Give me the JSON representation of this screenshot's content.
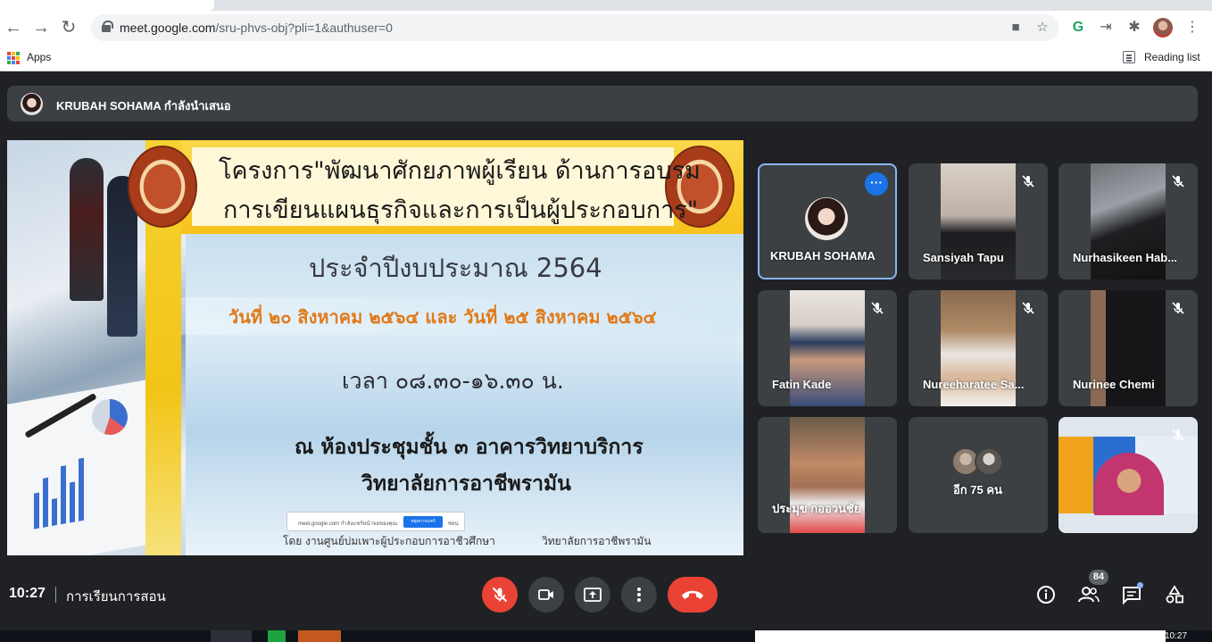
{
  "browser": {
    "url_host": "meet.google.com",
    "url_path": "/sru-phvs-obj?pli=1&authuser=0",
    "bookmarks": {
      "apps_label": "Apps",
      "reading_list_label": "Reading list"
    }
  },
  "presenter_bar": {
    "text": "KRUBAH SOHAMA กำลังนำเสนอ"
  },
  "slide": {
    "title_line1": "โครงการ\"พัฒนาศักยภาพผู้เรียน ด้านการอบรม",
    "title_line2": "การเขียนแผนธุรกิจและการเป็นผู้ประกอบการ\"",
    "fiscal_year": "ประจำปีงบประมาณ 2564",
    "date": "วันที่  ๒๐  สิงหาคม ๒๕๖๔  และ วันที่  ๒๕  สิงหาคม ๒๕๖๔",
    "time": "เวลา ๐๘.๓๐-๑๖.๓๐ น.",
    "venue1": "ณ ห้องประชุมชั้น ๓ อาคารวิทยาบริการ",
    "venue2": "วิทยาลัยการอาชีพรามัน",
    "footer_left": "โดย งานศูนย์บ่มเพาะผู้ประกอบการอาชีวศึกษา",
    "footer_right": "วิทยาลัยการอาชีพรามัน",
    "share_notice": {
      "text": "meet.google.com กำลังแชร์หน้าจอของคุณ",
      "stop": "หยุดการแชร์",
      "hide": "ซ่อน"
    }
  },
  "participants": [
    {
      "name": "KRUBAH SOHAMA",
      "active": true
    },
    {
      "name": "Sansiyah Tapu"
    },
    {
      "name": "Nurhasikeen Hab..."
    },
    {
      "name": "Fatin Kade"
    },
    {
      "name": "Nureeharatee Sa..."
    },
    {
      "name": "Nurinee Chemi"
    },
    {
      "name": "ประมุข กออวนชัย"
    },
    {
      "name": "อีก 75 คน"
    },
    {
      "name": ""
    }
  ],
  "bottom_bar": {
    "time": "10:27",
    "meeting_name": "การเรียนการสอน",
    "people_count": "84"
  },
  "taskbar": {
    "clock": "10:27"
  },
  "colors": {
    "meet_bg": "#202124",
    "tile_bg": "#3c4043",
    "red": "#ea4335",
    "active_border": "#8ab4f8",
    "blue": "#1a73e8"
  }
}
